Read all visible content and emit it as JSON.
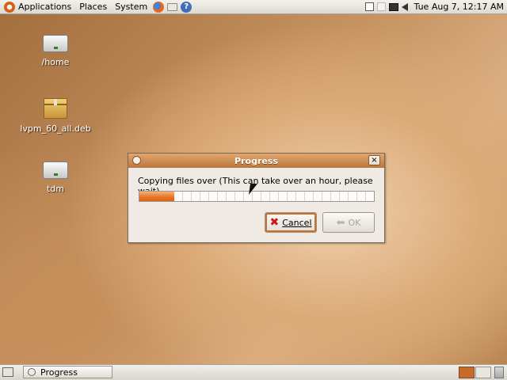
{
  "top_panel": {
    "menus": [
      "Applications",
      "Places",
      "System"
    ],
    "clock": "Tue Aug  7, 12:17 AM",
    "help_icon_glyph": "?"
  },
  "desktop_icons": [
    {
      "label": "/home",
      "icon": "drive-icon"
    },
    {
      "label": "lvpm_60_all.deb",
      "icon": "package-icon"
    },
    {
      "label": "tdm",
      "icon": "drive-icon"
    }
  ],
  "dialog": {
    "title": "Progress",
    "message": "Copying files over (This can take over an hour, please wait)",
    "progress_fraction": 0.15,
    "cancel_label": "Cancel",
    "ok_label": "OK",
    "close_glyph": "×"
  },
  "taskbar": {
    "items": [
      {
        "label": "Progress"
      }
    ]
  },
  "colors": {
    "accent": "#e8762a",
    "titlebar": "#c98a52"
  }
}
